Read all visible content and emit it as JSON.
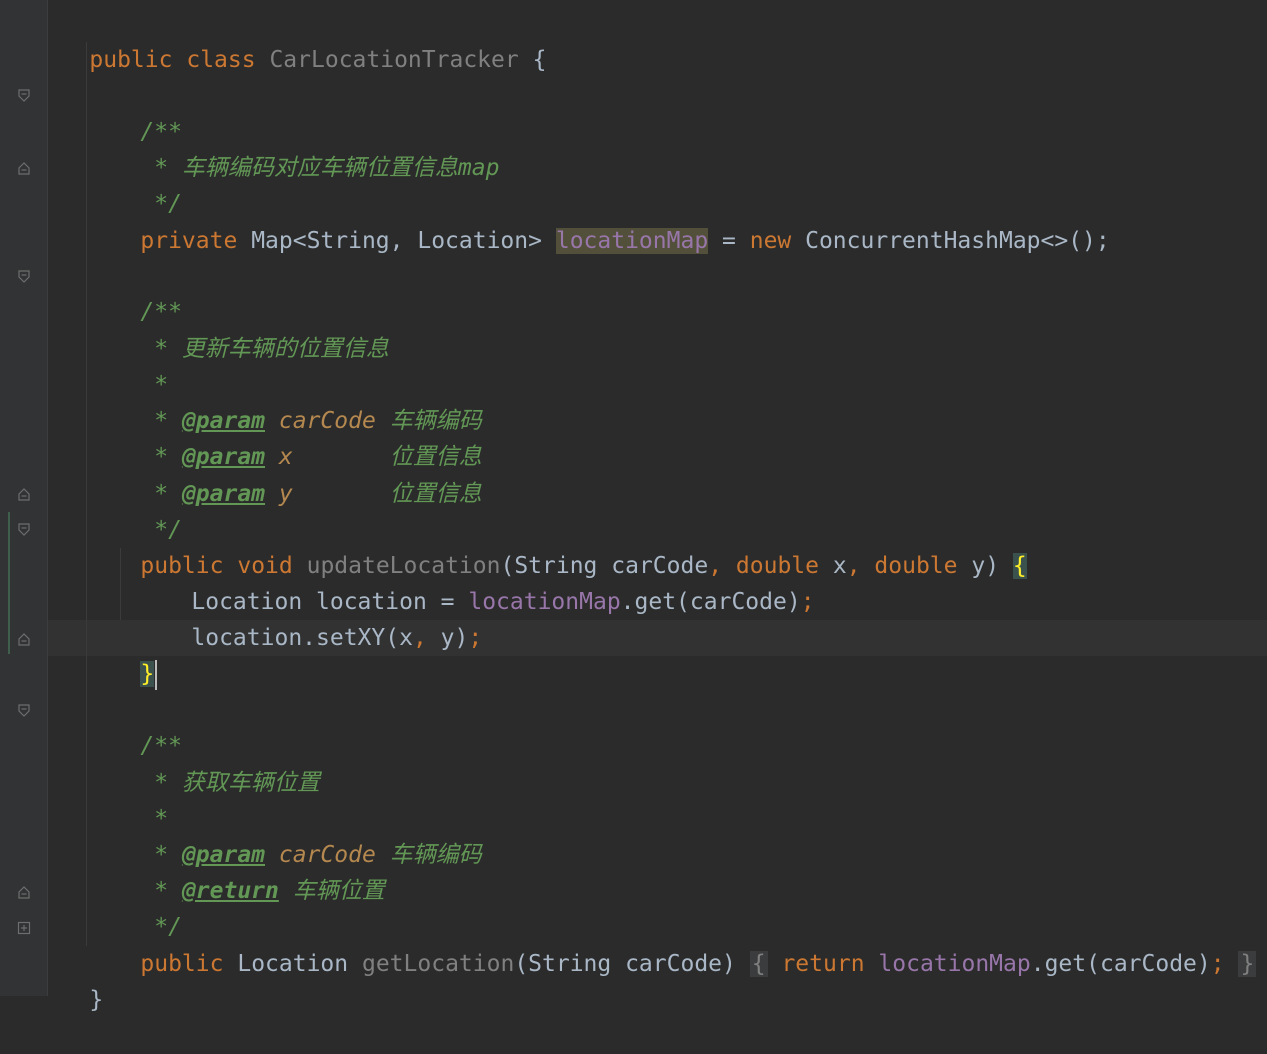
{
  "editor": {
    "lines": {
      "l1": {
        "kw1": "public",
        "kw2": "class",
        "name": "CarLocationTracker",
        "brace": "{"
      },
      "l3": {
        "text": "/**"
      },
      "l4": {
        "text": " * 车辆编码对应车辆位置信息map"
      },
      "l5": {
        "text": " */"
      },
      "l6": {
        "kw": "private",
        "type": "Map<String, Location>",
        "field": "locationMap",
        "eq": " = ",
        "kwnew": "new",
        "ctor": " ConcurrentHashMap<>();"
      },
      "l8": {
        "text": "/**"
      },
      "l9": {
        "text": " * 更新车辆的位置信息"
      },
      "l10": {
        "text": " *"
      },
      "l11": {
        "star": " * ",
        "tag": "@param",
        "name": "carCode",
        "desc": "车辆编码"
      },
      "l12": {
        "star": " * ",
        "tag": "@param",
        "name": "x",
        "desc": "位置信息"
      },
      "l13": {
        "star": " * ",
        "tag": "@param",
        "name": "y",
        "desc": "位置信息"
      },
      "l14": {
        "text": " */"
      },
      "l15": {
        "kw1": "public",
        "kw2": "void",
        "method": "updateLocation",
        "params_a": "(String carCode",
        "comma1": ",",
        "kwd1": "double",
        "params_b": " x",
        "comma2": ",",
        "kwd2": "double",
        "params_c": " y) ",
        "brace": "{"
      },
      "l16": {
        "a": "Location location = ",
        "field": "locationMap",
        "b": ".get(carCode)",
        "semi": ";"
      },
      "l17": {
        "a": "location.setXY(x",
        "comma": ",",
        "b": " y)",
        "semi": ";"
      },
      "l18": {
        "brace": "}"
      },
      "l20": {
        "text": "/**"
      },
      "l21": {
        "text": " * 获取车辆位置"
      },
      "l22": {
        "text": " *"
      },
      "l23": {
        "star": " * ",
        "tag": "@param",
        "name": "carCode",
        "desc": "车辆编码"
      },
      "l24": {
        "star": " * ",
        "tag": "@return",
        "desc": "车辆位置"
      },
      "l25": {
        "text": " */"
      },
      "l26": {
        "kw1": "public",
        "type": "Location",
        "method": "getLocation",
        "params": "(String carCode)",
        "ob": "{",
        "kwret": "return",
        "field": "locationMap",
        "call": ".get(carCode)",
        "semi": ";",
        "cb": "}"
      },
      "l27": {
        "brace": "}"
      }
    },
    "colors": {
      "background": "#2b2b2b",
      "keyword": "#cc7832",
      "doc": "#629755",
      "field": "#9876aa",
      "text": "#a9b7c6"
    }
  }
}
